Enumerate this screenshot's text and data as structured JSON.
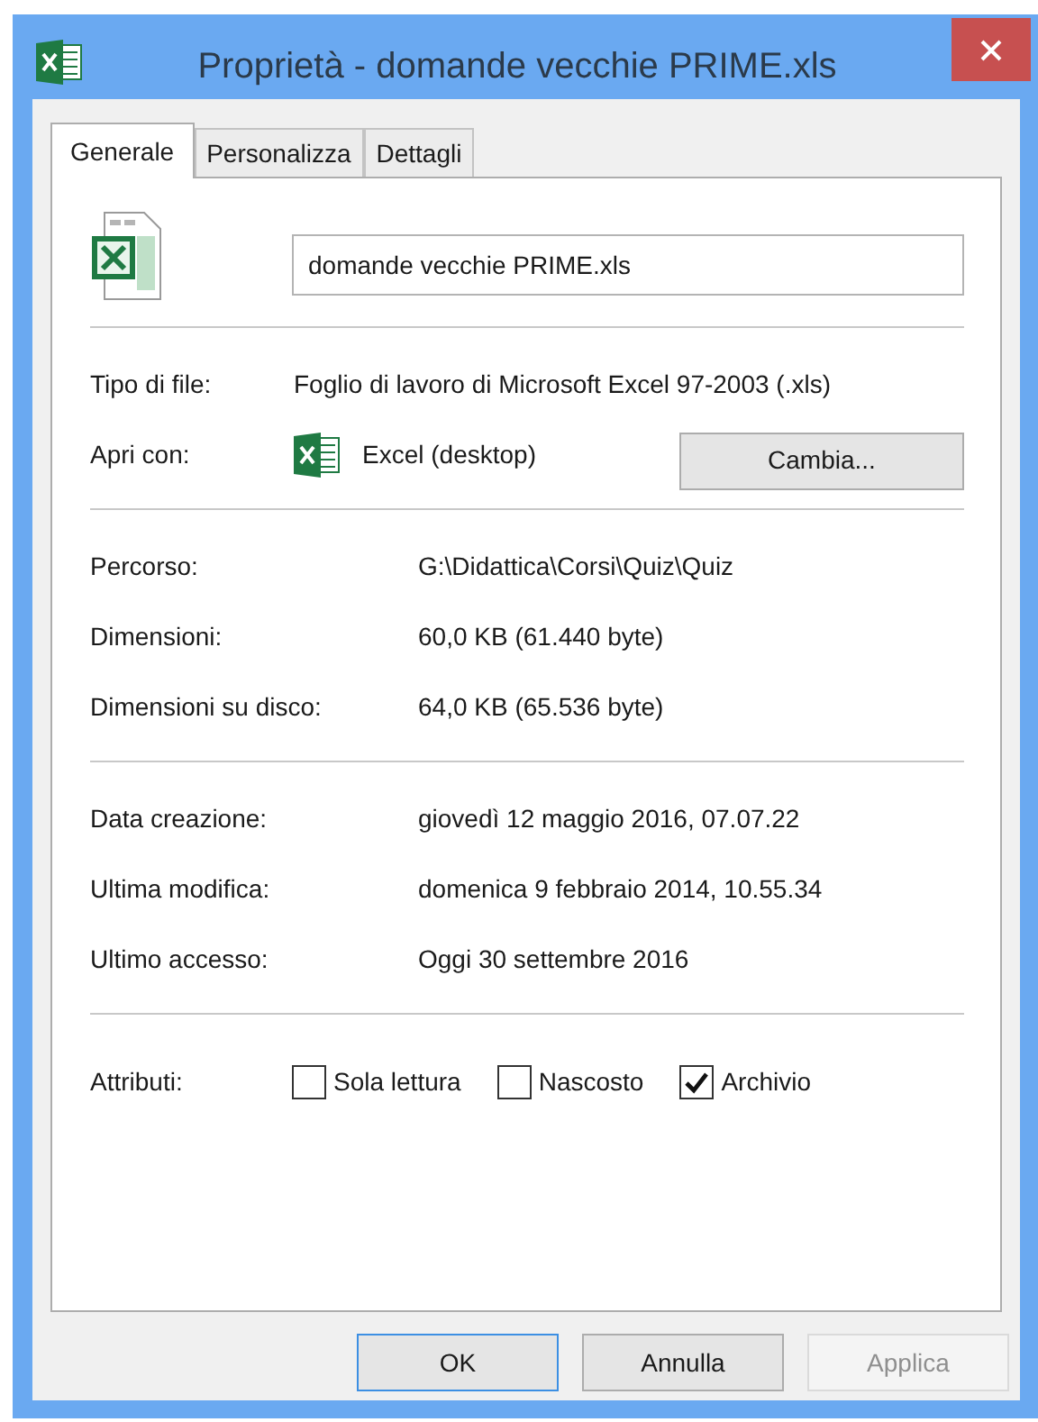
{
  "window": {
    "title": "Proprietà - domande vecchie PRIME.xls"
  },
  "tabs": [
    {
      "label": "Generale",
      "selected": true
    },
    {
      "label": "Personalizza",
      "selected": false
    },
    {
      "label": "Dettagli",
      "selected": false
    }
  ],
  "file_name": {
    "value": "domande vecchie PRIME.xls"
  },
  "type_section": {
    "file_type": {
      "label": "Tipo di file:",
      "value": "Foglio di lavoro di Microsoft Excel 97-2003 (.xls)"
    },
    "open_with": {
      "label": "Apri con:",
      "app": "Excel (desktop)",
      "button": "Cambia..."
    }
  },
  "location_section": [
    {
      "label": "Percorso:",
      "value": "G:\\Didattica\\Corsi\\Quiz\\Quiz"
    },
    {
      "label": "Dimensioni:",
      "value": "60,0 KB (61.440 byte)"
    },
    {
      "label": "Dimensioni su disco:",
      "value": "64,0 KB (65.536 byte)"
    }
  ],
  "dates_section": [
    {
      "label": "Data creazione:",
      "value": "giovedì 12 maggio 2016, 07.07.22"
    },
    {
      "label": "Ultima modifica:",
      "value": "domenica 9 febbraio 2014, 10.55.34"
    },
    {
      "label": "Ultimo accesso:",
      "value": "Oggi 30 settembre 2016"
    }
  ],
  "attributes": {
    "label": "Attributi:",
    "items": [
      {
        "label": "Sola lettura",
        "checked": false
      },
      {
        "label": "Nascosto",
        "checked": false
      },
      {
        "label": "Archivio",
        "checked": true
      }
    ]
  },
  "buttons": [
    {
      "label": "OK",
      "focused": true,
      "disabled": false
    },
    {
      "label": "Annulla",
      "focused": false,
      "disabled": false
    },
    {
      "label": "Applica",
      "focused": false,
      "disabled": true
    }
  ]
}
